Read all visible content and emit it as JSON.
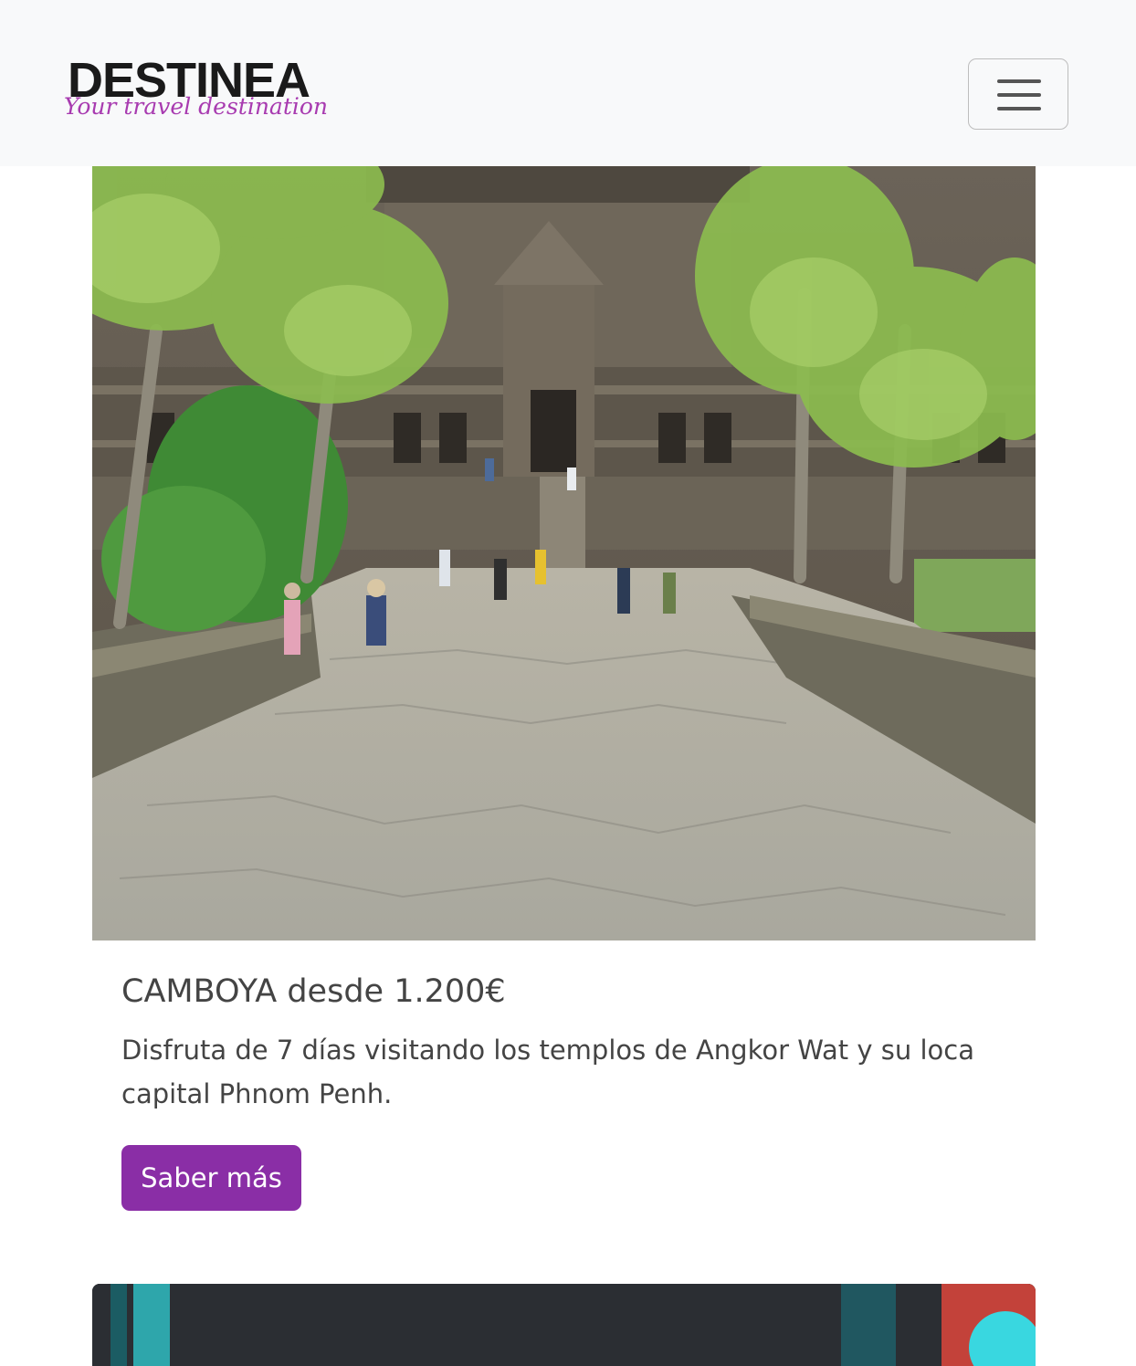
{
  "brand": {
    "name": "DESTINEA",
    "tagline": "Your travel destination"
  },
  "navbar": {
    "toggler_icon": "hamburger-menu-icon"
  },
  "cards": [
    {
      "image_subject": "Angkor Wat temple causeway",
      "title": "CAMBOYA desde 1.200€",
      "text": "Disfruta de 7 días visitando los templos de Angkor Wat y su loca capital Phnom Penh.",
      "button_label": "Saber más"
    }
  ],
  "colors": {
    "accent": "#8a2ea6",
    "tagline": "#a83bb0",
    "navbar_bg": "#f8f9fa"
  }
}
